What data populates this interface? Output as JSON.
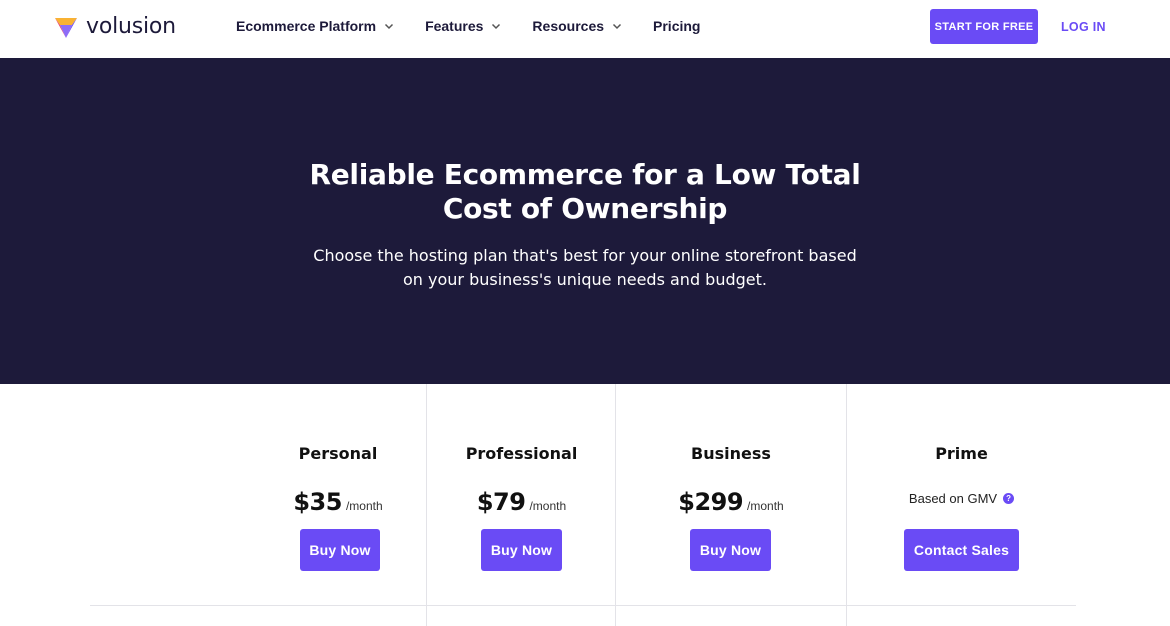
{
  "header": {
    "logo_text": "volusion",
    "nav": [
      {
        "label": "Ecommerce Platform",
        "has_dropdown": true
      },
      {
        "label": "Features",
        "has_dropdown": true
      },
      {
        "label": "Resources",
        "has_dropdown": true
      },
      {
        "label": "Pricing",
        "has_dropdown": false
      }
    ],
    "start_label": "START FOR FREE",
    "login_label": "LOG IN"
  },
  "hero": {
    "title_line1": "Reliable Ecommerce for a Low Total",
    "title_line2": "Cost of Ownership",
    "subtitle_line1": "Choose the hosting plan that's best for your online storefront based",
    "subtitle_line2": "on your business's unique needs and budget."
  },
  "plans": [
    {
      "name": "Personal",
      "price": "$35",
      "per": "/month",
      "button": "Buy Now"
    },
    {
      "name": "Professional",
      "price": "$79",
      "per": "/month",
      "button": "Buy Now"
    },
    {
      "name": "Business",
      "price": "$299",
      "per": "/month",
      "button": "Buy Now"
    },
    {
      "name": "Prime",
      "price_note": "Based on GMV",
      "button": "Contact Sales"
    }
  ],
  "colors": {
    "accent": "#6a4bf5",
    "hero_bg": "#1d1a3a",
    "text_dark": "#1d1a3a"
  },
  "icons": {
    "logo": "volusion-logo-icon",
    "dropdown": "chevron-down-icon",
    "help": "question-circle-icon"
  }
}
